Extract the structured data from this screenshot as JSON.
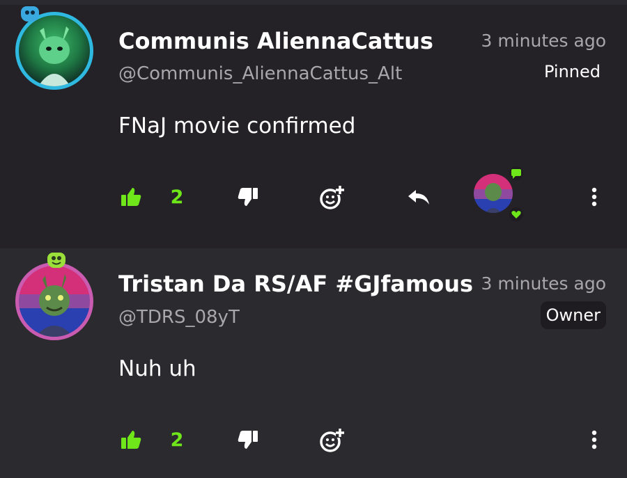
{
  "colors": {
    "background": "#1e1c21",
    "card_1": "#242227",
    "card_2": "#2b2a2f",
    "accent_green": "#6ee619",
    "muted_text": "#a9a6ad"
  },
  "comments": [
    {
      "username": "Communis AliennaCattus",
      "handle": "@Communis_AliennaCattus_Alt",
      "time": "3 minutes ago",
      "tag": "Pinned",
      "text": "FNaJ movie confirmed",
      "likes": "2",
      "icons": [
        "thumbs-up-icon",
        "thumbs-down-icon",
        "add-reaction-icon",
        "reply-icon",
        "more-icon"
      ],
      "liked_by_owner": true
    },
    {
      "username": "Tristan Da RS/AF #GJfamous",
      "handle": "@TDRS_08yT",
      "time": "3 minutes ago",
      "tag": "Owner",
      "text": "Nuh uh",
      "likes": "2",
      "icons": [
        "thumbs-up-icon",
        "thumbs-down-icon",
        "add-reaction-icon",
        "more-icon"
      ]
    }
  ]
}
